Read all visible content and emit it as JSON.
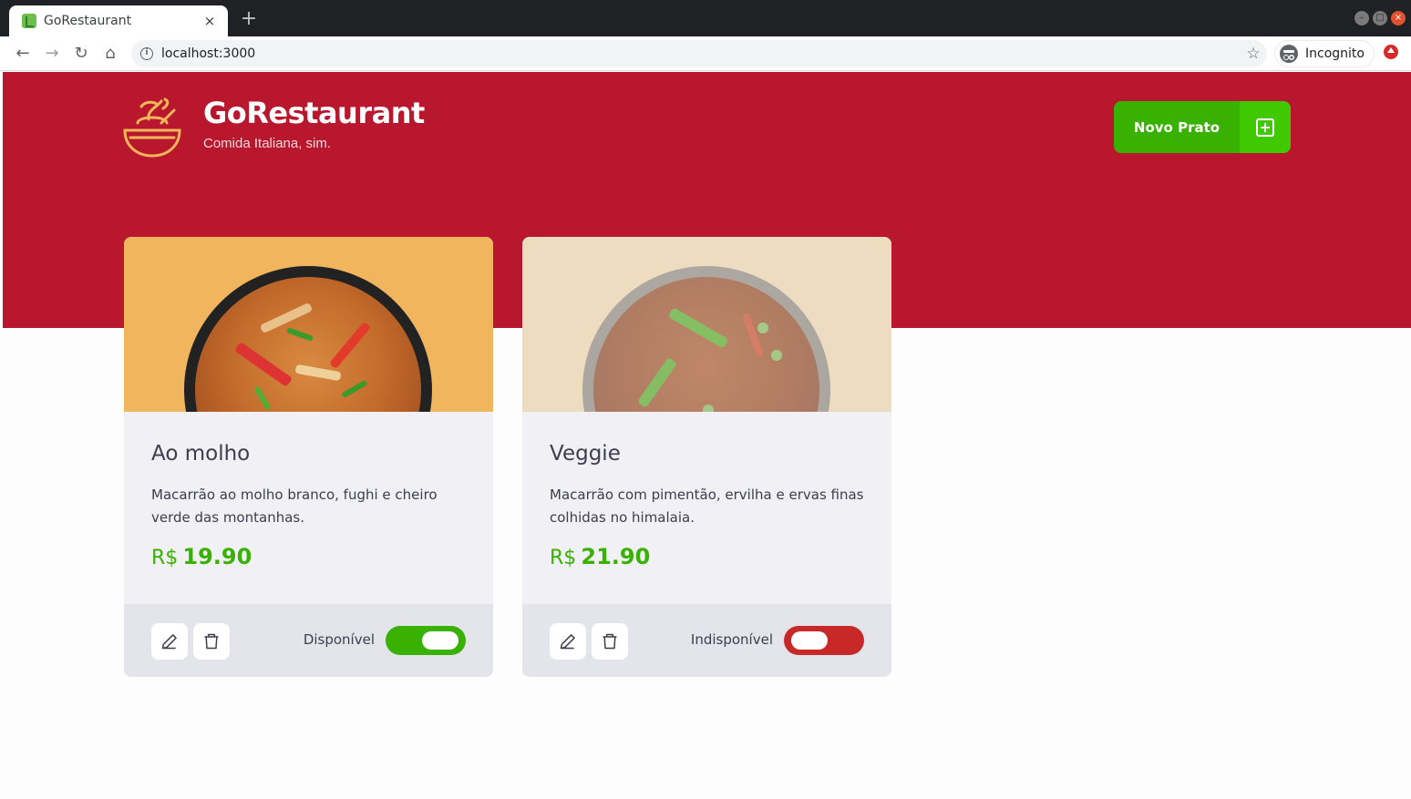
{
  "browser": {
    "tab_title": "GoRestaurant",
    "tab_close": "×",
    "new_tab": "+",
    "url": "localhost:3000",
    "profile_label": "Incognito"
  },
  "header": {
    "title": "GoRestaurant",
    "subtitle": "Comida Italiana, sim.",
    "new_dish_label": "Novo Prato"
  },
  "foods": [
    {
      "name": "Ao molho",
      "description": "Macarrão ao molho branco, fughi e cheiro verde das montanhas.",
      "currency": "R$",
      "price": "19.90",
      "available_label": "Disponível",
      "available": true
    },
    {
      "name": "Veggie",
      "description": "Macarrão com pimentão, ervilha e ervas finas colhidas no himalaia.",
      "currency": "R$",
      "price": "21.90",
      "available_label": "Indisponível",
      "available": false
    }
  ],
  "colors": {
    "brand_red": "#b8172d",
    "green": "#39b100",
    "toggle_off": "#c72828",
    "card_bg": "#f0f0f5"
  },
  "icons": {
    "logo": "bowl-icon",
    "new_dish": "plus-square-icon",
    "edit": "edit-icon",
    "delete": "trash-icon"
  }
}
